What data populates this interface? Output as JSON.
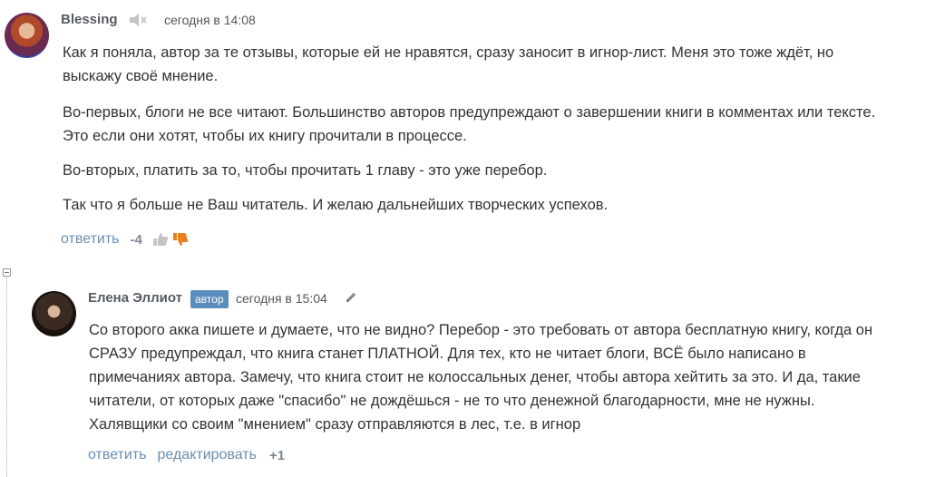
{
  "comments": [
    {
      "author": "Blessing",
      "date": "сегодня в 14:08",
      "muted_icon": "speaker-muted-icon",
      "paragraphs": [
        "Как я поняла, автор за те отзывы, которые ей не нравятся, сразу заносит в игнор-лист. Меня это тоже ждёт, но",
        "выскажу своё мнение.",
        "Во-первых, блоги не все читают. Большинство авторов предупреждают о завершении книги в комментах или тексте.",
        "Это если они хотят, чтобы их книгу прочитали в процессе.",
        "Во-вторых, платить за то, чтобы прочитать 1 главу - это уже перебор.",
        "Так что я больше не Ваш читатель. И желаю дальнейших творческих успехов."
      ],
      "reply_label": "ответить",
      "score": "-4",
      "like_icon": "thumbs-up-icon",
      "dislike_icon": "thumbs-down-icon"
    },
    {
      "author": "Елена Эллиот",
      "badge": "автор",
      "date": "сегодня в 15:04",
      "edit_icon": "pencil-icon",
      "lines": [
        "Со второго акка пишете и думаете, что не видно? Перебор - это требовать от автора бесплатную книгу, когда он",
        "СРАЗУ предупреждал, что книга станет ПЛАТНОЙ. Для тех, кто не читает блоги, ВСЁ было написано в",
        "примечаниях автора. Замечу, что книга стоит не колоссальных денег, чтобы автора хейтить за это. И да, такие",
        "читатели, от которых даже \"спасибо\" не дождёшься - не то что денежной благодарности, мне не нужны.",
        "Халявщики со своим \"мнением\" сразу отправляются в лес, т.е. в игнор"
      ],
      "reply_label": "ответить",
      "edit_label": "редактировать",
      "score": "+1"
    }
  ],
  "collapse_icon": "collapse-minus-icon"
}
